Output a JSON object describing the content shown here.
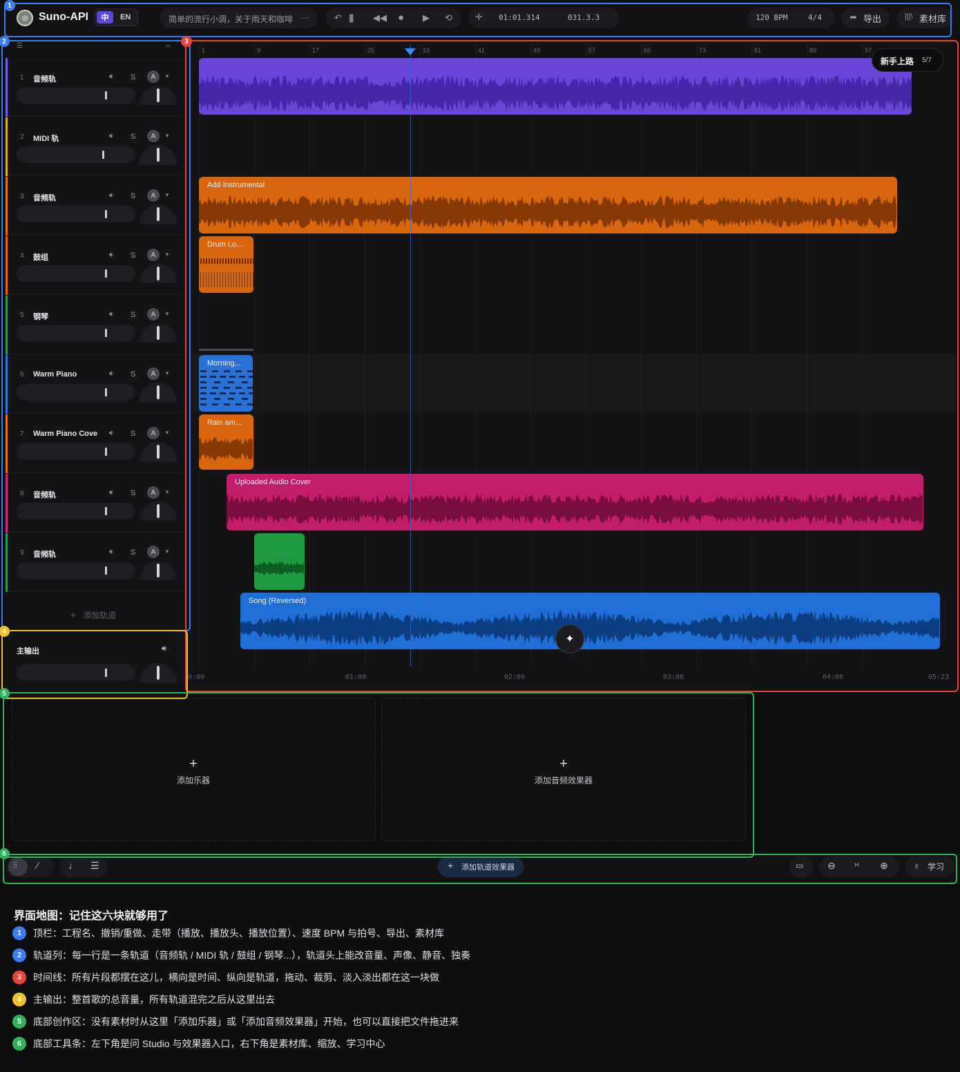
{
  "topbar": {
    "app_name": "Suno-API",
    "lang_zh": "中",
    "lang_en": "EN",
    "project_desc": "简单的流行小调，关于雨天和咖啡",
    "more": "···",
    "time": "01:01.314",
    "position": "031.3.3",
    "bpm": "120 BPM",
    "signature": "4/4",
    "export_label": "导出",
    "library_label": "素材库"
  },
  "tracks": [
    {
      "num": "1",
      "name": "音频轨",
      "solo": "S",
      "auto": "A",
      "color": "#7b5cf0"
    },
    {
      "num": "2",
      "name": "MIDI 轨",
      "solo": "S",
      "auto": "A",
      "color": "#e0b020"
    },
    {
      "num": "3",
      "name": "音频轨",
      "solo": "S",
      "auto": "A",
      "color": "#e0701a"
    },
    {
      "num": "4",
      "name": "鼓组",
      "solo": "S",
      "auto": "A",
      "color": "#e06418"
    },
    {
      "num": "5",
      "name": "钢琴",
      "solo": "S",
      "auto": "A",
      "color": "#28a050"
    },
    {
      "num": "6",
      "name": "Warm Piano",
      "solo": "S",
      "auto": "A",
      "color": "#2a78e0"
    },
    {
      "num": "7",
      "name": "Warm Piano Cove",
      "solo": "S",
      "auto": "A",
      "color": "#e0701a"
    },
    {
      "num": "8",
      "name": "音频轨",
      "solo": "S",
      "auto": "A",
      "color": "#d02a7a"
    },
    {
      "num": "9",
      "name": "音频轨",
      "solo": "S",
      "auto": "A",
      "color": "#28a050"
    }
  ],
  "add_track_label": "添加轨道",
  "master_label": "主输出",
  "ruler": [
    "1",
    "9",
    "17",
    "25",
    "33",
    "41",
    "49",
    "57",
    "65",
    "73",
    "81",
    "89",
    "97"
  ],
  "time_labels": [
    "0:00",
    "01:00",
    "02:00",
    "03:00",
    "04:00",
    "05:23"
  ],
  "clips": {
    "c2": "Add Instrumental",
    "c3": "Drum Lo...",
    "c5": "Morning...",
    "c6": "Rain am...",
    "c7": "Uploaded Audio Cover",
    "c9": "Song (Reversed)"
  },
  "tooltip": {
    "label": "新手上路",
    "progress": "5/7"
  },
  "bottom": {
    "add_instrument": "添加乐器",
    "add_audio_fx": "添加音频效果器",
    "add_track_fx": "添加轨道效果器",
    "learn": "学习",
    "plus": "+"
  },
  "badges": [
    "1",
    "2",
    "3",
    "4",
    "5",
    "6"
  ],
  "colors": {
    "blue": "#3b7cf0",
    "red": "#e8443a",
    "yellow": "#f2c12e",
    "green": "#2fb45a"
  },
  "legend": {
    "title": "界面地图：记住这六块就够用了",
    "items": [
      {
        "n": "1",
        "text": "顶栏：工程名、撤销/重做、走带（播放、播放头、播放位置）、速度 BPM 与拍号、导出、素材库",
        "color": "#3b7cf0"
      },
      {
        "n": "2",
        "text": "轨道列：每一行是一条轨道（音频轨 / MIDI 轨 / 鼓组 / 钢琴...），轨道头上能改音量、声像、静音、独奏",
        "color": "#3b7cf0"
      },
      {
        "n": "3",
        "text": "时间线：所有片段都摆在这儿，横向是时间、纵向是轨道，拖动、裁剪、淡入淡出都在这一块做",
        "color": "#e8443a"
      },
      {
        "n": "4",
        "text": "主输出：整首歌的总音量，所有轨道混完之后从这里出去",
        "color": "#f2c12e"
      },
      {
        "n": "5",
        "text": "底部创作区：没有素材时从这里「添加乐器」或「添加音频效果器」开始，也可以直接把文件拖进来",
        "color": "#2fb45a"
      },
      {
        "n": "6",
        "text": "底部工具条：左下角是问 Studio 与效果器入口，右下角是素材库、缩放、学习中心",
        "color": "#2fb45a"
      }
    ]
  }
}
